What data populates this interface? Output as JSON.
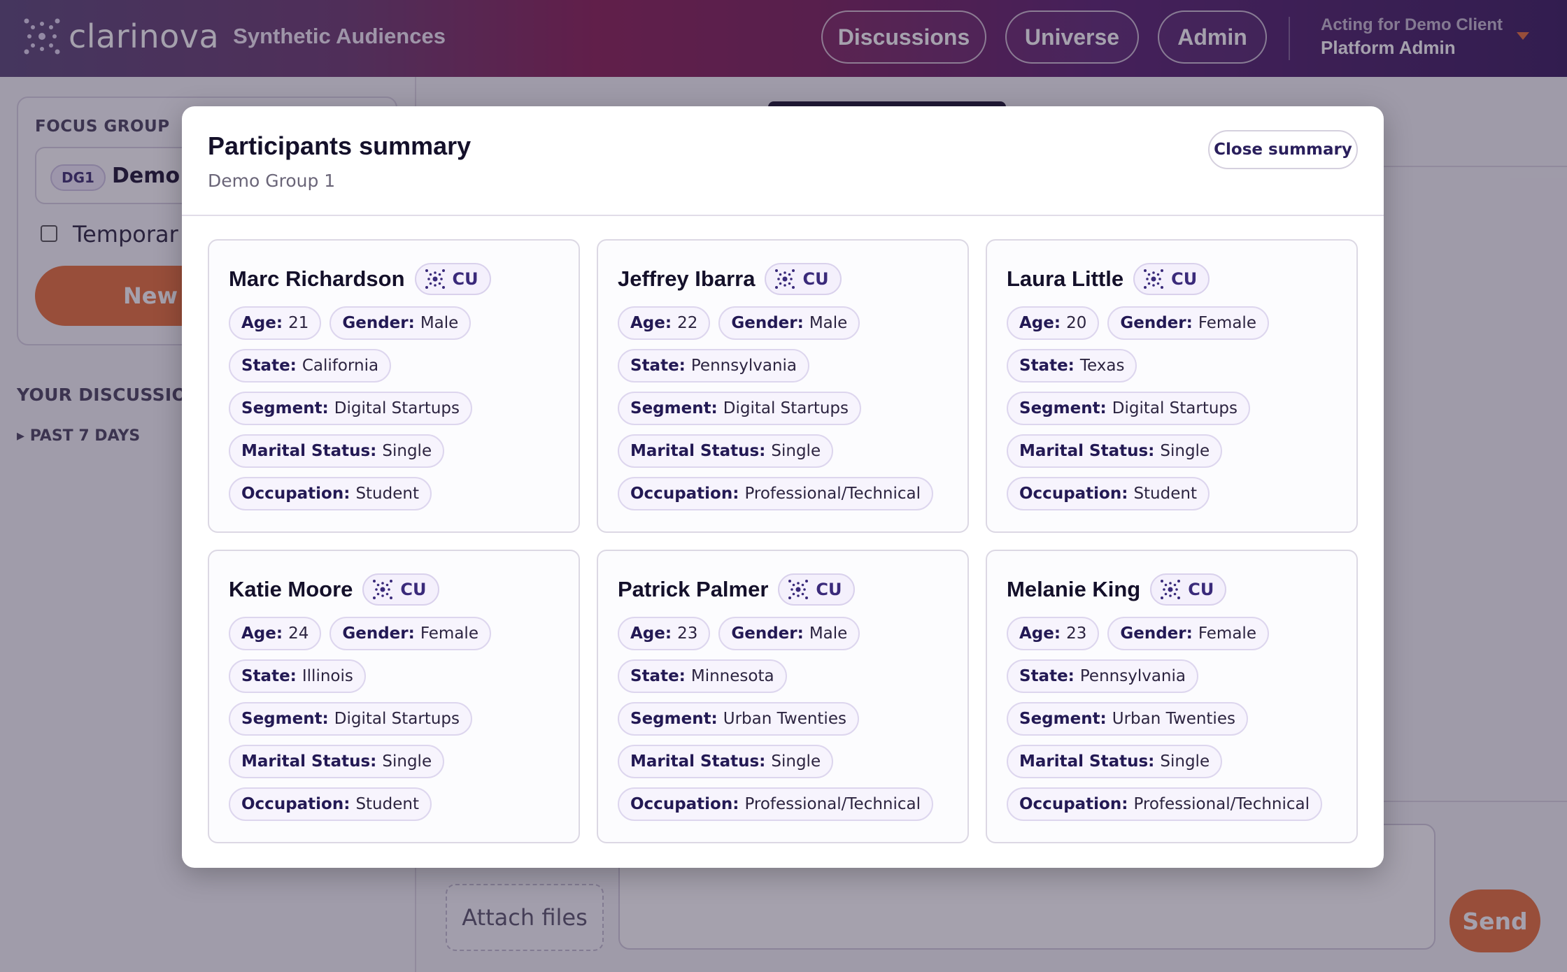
{
  "header": {
    "brand": "clarinova",
    "product": "Synthetic Audiences",
    "nav": [
      "Discussions",
      "Universe",
      "Admin"
    ],
    "acting_line1": "Acting for Demo Client",
    "acting_line2": "Platform Admin"
  },
  "sidebar": {
    "focus_label": "FOCUS GROUP",
    "group_tag": "DG1",
    "group_name": "Demo G",
    "temporary_label": "Temporar",
    "new_button": "New d",
    "your_discussions": "YOUR DISCUSSION",
    "past_label": "▸ PAST 7 DAYS"
  },
  "composer": {
    "attach_label": "Attach files",
    "send_label": "Send"
  },
  "modal": {
    "title": "Participants summary",
    "subtitle": "Demo Group 1",
    "close_label": "Close summary",
    "labels": {
      "age": "Age:",
      "gender": "Gender:",
      "state": "State:",
      "segment": "Segment:",
      "marital": "Marital Status:",
      "occupation": "Occupation:"
    },
    "participants": [
      {
        "name": "Marc Richardson",
        "badge": "CU",
        "age": "21",
        "gender": "Male",
        "state": "California",
        "segment": "Digital Startups",
        "marital": "Single",
        "occupation": "Student"
      },
      {
        "name": "Jeffrey Ibarra",
        "badge": "CU",
        "age": "22",
        "gender": "Male",
        "state": "Pennsylvania",
        "segment": "Digital Startups",
        "marital": "Single",
        "occupation": "Professional/Technical"
      },
      {
        "name": "Laura Little",
        "badge": "CU",
        "age": "20",
        "gender": "Female",
        "state": "Texas",
        "segment": "Digital Startups",
        "marital": "Single",
        "occupation": "Student"
      },
      {
        "name": "Katie Moore",
        "badge": "CU",
        "age": "24",
        "gender": "Female",
        "state": "Illinois",
        "segment": "Digital Startups",
        "marital": "Single",
        "occupation": "Student"
      },
      {
        "name": "Patrick Palmer",
        "badge": "CU",
        "age": "23",
        "gender": "Male",
        "state": "Minnesota",
        "segment": "Urban Twenties",
        "marital": "Single",
        "occupation": "Professional/Technical"
      },
      {
        "name": "Melanie King",
        "badge": "CU",
        "age": "23",
        "gender": "Female",
        "state": "Pennsylvania",
        "segment": "Urban Twenties",
        "marital": "Single",
        "occupation": "Professional/Technical"
      }
    ]
  },
  "colors": {
    "accent": "#e8713a",
    "brand_dark": "#2a1f5c"
  }
}
